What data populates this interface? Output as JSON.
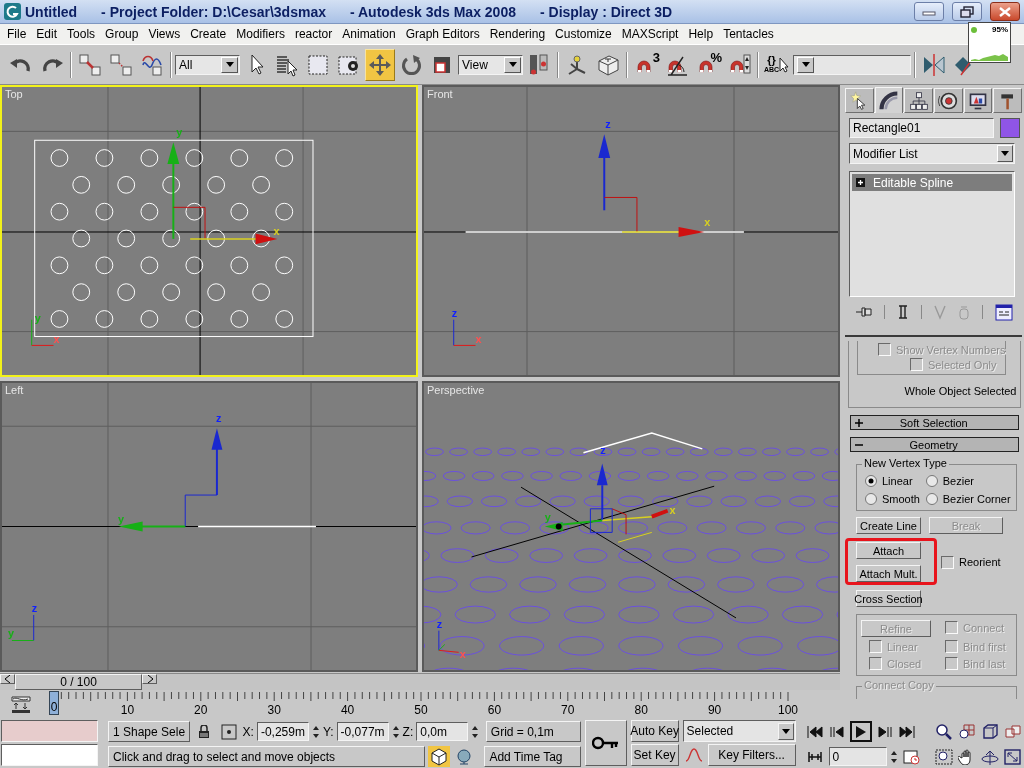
{
  "window": {
    "title_parts": [
      "Untitled",
      "- Project Folder: D:\\Cesar\\3dsmax",
      "- Autodesk 3ds Max 2008",
      "- Display : Direct 3D"
    ]
  },
  "menu": [
    "File",
    "Edit",
    "Tools",
    "Group",
    "Views",
    "Create",
    "Modifiers",
    "reactor",
    "Animation",
    "Graph Editors",
    "Rendering",
    "Customize",
    "MAXScript",
    "Help",
    "Tentacles"
  ],
  "memory_meter": {
    "reading": "95%"
  },
  "toolbar": {
    "groups": [
      [
        {
          "kind": "undo",
          "selected": false
        },
        {
          "kind": "redo",
          "selected": false
        }
      ],
      [
        {
          "kind": "link",
          "selected": false
        },
        {
          "kind": "unlink",
          "selected": false
        },
        {
          "kind": "bind",
          "selected": false
        }
      ],
      [
        {
          "kind": "dropdown",
          "value": "All"
        },
        {
          "kind": "select",
          "selected": false
        },
        {
          "kind": "select-by-name",
          "selected": false
        },
        {
          "kind": "region",
          "selected": false
        },
        {
          "kind": "crossing",
          "selected": false
        },
        {
          "kind": "move",
          "selected": true
        },
        {
          "kind": "rotate",
          "selected": false
        },
        {
          "kind": "scale",
          "selected": false
        },
        {
          "kind": "dropdown",
          "value": "View"
        },
        {
          "kind": "pivot",
          "selected": false
        }
      ],
      [
        {
          "kind": "manipulate",
          "selected": false
        },
        {
          "kind": "keyboard",
          "selected": false
        }
      ],
      [
        {
          "kind": "snap",
          "label": "3",
          "selected": false
        },
        {
          "kind": "angle-snap",
          "selected": false
        },
        {
          "kind": "percent-snap",
          "label": "%",
          "selected": false
        },
        {
          "kind": "spinner-snap",
          "selected": false
        }
      ],
      [
        {
          "kind": "named-selection",
          "label": "{}",
          "sublabel": "ABC",
          "selected": false
        },
        {
          "kind": "dropdown"
        }
      ],
      [
        {
          "kind": "mirror",
          "selected": false
        },
        {
          "kind": "align",
          "selected": false
        }
      ]
    ]
  },
  "viewports": [
    {
      "label": "Top",
      "kind": "top",
      "active": true,
      "gizmo_axes": [
        "y",
        "x"
      ],
      "tripod_axes": [
        "y",
        "x"
      ]
    },
    {
      "label": "Front",
      "kind": "front",
      "active": false,
      "gizmo_axes": [
        "z",
        "x"
      ],
      "tripod_axes": [
        "z",
        "x"
      ]
    },
    {
      "label": "Left",
      "kind": "left",
      "active": false,
      "gizmo_axes": [
        "z",
        "y"
      ],
      "tripod_axes": [
        "z",
        "y"
      ]
    },
    {
      "label": "Perspective",
      "kind": "perspective",
      "active": false,
      "gizmo_axes": [
        "z",
        "y",
        "x"
      ],
      "tripod_axes": [
        "z",
        "x"
      ]
    }
  ],
  "command_panel": {
    "tabs": [
      {
        "kind": "create",
        "selected": false
      },
      {
        "kind": "modify",
        "selected": true
      },
      {
        "kind": "hierarchy",
        "selected": false
      },
      {
        "kind": "motion",
        "selected": false
      },
      {
        "kind": "display",
        "selected": false
      },
      {
        "kind": "utilities",
        "selected": false
      }
    ],
    "object": {
      "name": "Rectangle01",
      "color": "#8f55e6"
    },
    "modifier_list": "Modifier List",
    "stack": [
      {
        "label": "Editable Spline",
        "expanded": false,
        "selected": true
      }
    ],
    "display_options": [
      {
        "label": "Show Vertex Numbers",
        "checked": false,
        "disabled": true
      },
      {
        "label": "Selected Only",
        "checked": false,
        "disabled": true
      }
    ],
    "selection_info": "Whole Object Selected",
    "rollouts": [
      {
        "title": "Soft Selection",
        "expanded": false
      },
      {
        "title": "Geometry",
        "expanded": true
      }
    ],
    "vertex_type": {
      "title": "New Vertex Type",
      "options": [
        {
          "label": "Linear",
          "selected": true
        },
        {
          "label": "Bezier",
          "selected": false
        },
        {
          "label": "Smooth",
          "selected": false
        },
        {
          "label": "Bezier Corner",
          "selected": false
        }
      ]
    },
    "create_line": {
      "label": "Create Line",
      "disabled": false
    },
    "break": {
      "label": "Break",
      "disabled": true
    },
    "attach": {
      "label": "Attach",
      "disabled": false
    },
    "attach_mult": {
      "label": "Attach Mult.",
      "disabled": false
    },
    "reorient": {
      "label": "Reorient",
      "checked": false,
      "disabled": false
    },
    "cross_section": {
      "label": "Cross Section",
      "disabled": false
    },
    "refine": {
      "label": "Refine",
      "disabled": true
    },
    "refine_options": [
      {
        "label": "Connect",
        "checked": false,
        "disabled": true
      },
      {
        "label": "Linear",
        "checked": false,
        "disabled": true
      },
      {
        "label": "Bind first",
        "checked": false,
        "disabled": true
      },
      {
        "label": "Closed",
        "checked": false,
        "disabled": true
      },
      {
        "label": "Bind last",
        "checked": false,
        "disabled": true
      }
    ],
    "connect_copy": "Connect Copy"
  },
  "time_slider": {
    "reading": "0 / 100",
    "level": 0
  },
  "track_bar": {
    "current": "0",
    "labels": [
      "10",
      "20",
      "30",
      "40",
      "50",
      "60",
      "70",
      "80",
      "90",
      "100"
    ]
  },
  "status": {
    "selection": "1 Shape Sele",
    "x_label": "X:",
    "x": "-0,259m",
    "y_label": "Y:",
    "y": "-0,077m",
    "z_label": "Z:",
    "z": "0,0m",
    "grid": "Grid = 0,1m",
    "prompt": "Click and drag to select and move objects",
    "add_time_tag": "Add Time Tag",
    "auto_key": "Auto Key",
    "key_mode": "Selected",
    "set_key": "Set Key",
    "key_filters": "Key Filters...",
    "frame": "0"
  }
}
